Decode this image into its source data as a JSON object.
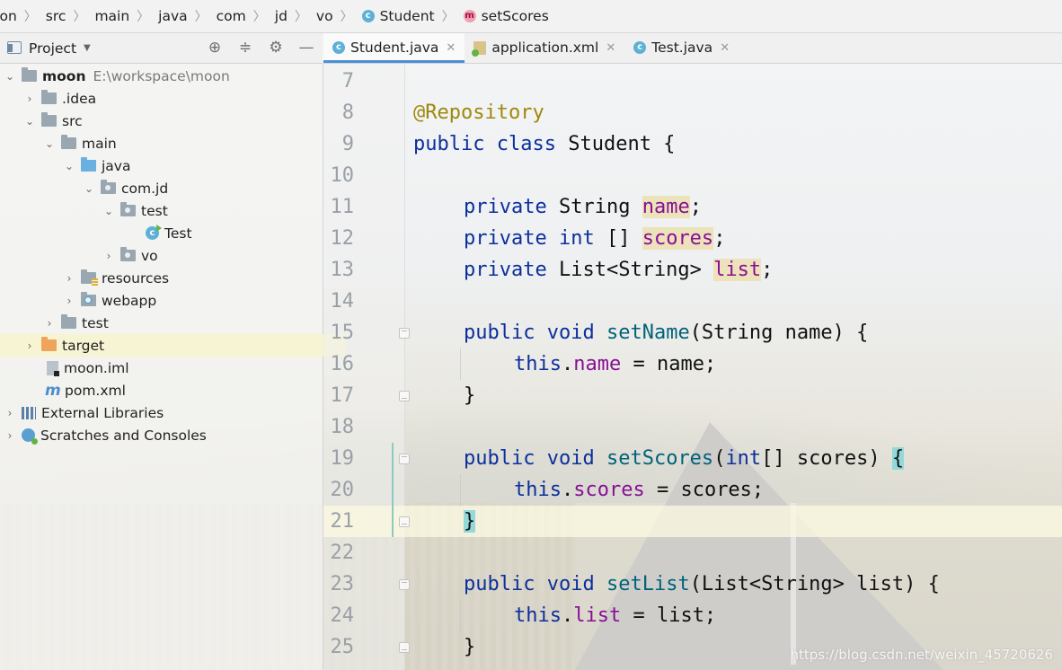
{
  "breadcrumb": [
    "oon",
    "src",
    "main",
    "java",
    "com",
    "jd",
    "vo",
    "Student",
    "setScores"
  ],
  "project_panel": {
    "title": "Project"
  },
  "tree": {
    "root": {
      "name": "moon",
      "path": "E:\\workspace\\moon"
    },
    "idea": ".idea",
    "src": "src",
    "main": "main",
    "java": "java",
    "comjd": "com.jd",
    "test_pkg": "test",
    "test_class": "Test",
    "vo": "vo",
    "resources": "resources",
    "webapp": "webapp",
    "test_dir": "test",
    "target": "target",
    "moon_iml": "moon.iml",
    "pom": "pom.xml",
    "ext_libs": "External Libraries",
    "scratches": "Scratches and Consoles"
  },
  "tabs": [
    {
      "label": "Student.java",
      "active": true
    },
    {
      "label": "application.xml",
      "active": false
    },
    {
      "label": "Test.java",
      "active": false
    }
  ],
  "code": {
    "line_numbers": [
      "7",
      "8",
      "9",
      "10",
      "11",
      "12",
      "13",
      "14",
      "15",
      "16",
      "17",
      "18",
      "19",
      "20",
      "21",
      "22",
      "23",
      "24",
      "25"
    ],
    "annotation": "@Repository",
    "kw_public": "public",
    "kw_class": "class",
    "class_name": "Student {",
    "kw_private": "private",
    "kw_void": "void",
    "kw_int": "int",
    "kw_this": "this",
    "type_string": "String",
    "type_list": "List<String>",
    "f_name": "name",
    "f_scores": "scores",
    "f_list": "list",
    "m_setName": "setName",
    "m_setScores": "setScores",
    "m_setList": "setList",
    "p_setName": "(String name) {",
    "p_setScores_open": "(",
    "p_setScores_close": "[] scores) ",
    "p_setList": "(List<String> list) {",
    "open_brace": "{",
    "close_brace": "}",
    "semicolon": ";",
    "int_arr": " [] ",
    "assign_name": " = name;",
    "assign_scores": " = scores;",
    "assign_list": " = list;",
    "dot": "."
  },
  "watermark": "https://blog.csdn.net/weixin_45720626",
  "colors": {
    "keyword": "#0b2f9c",
    "annotation": "#9e880d",
    "field": "#871094",
    "method": "#00627a",
    "accent": "#4c8fd8"
  }
}
